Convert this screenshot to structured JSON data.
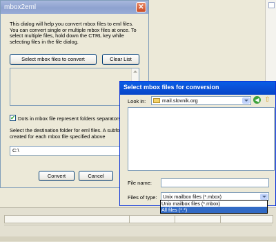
{
  "mbox2eml": {
    "title": "mbox2eml",
    "close_glyph": "✕",
    "description": "This dialog will help you convert mbox files to eml files. You can convert single or multiple mbox files at once. To select multiple files, hold down the CTRL key while selecting files in the file dialog.",
    "select_button": "Select mbox files to convert",
    "clear_button": "Clear List",
    "checkbox_label": "Dots in mbox file represent folders separators",
    "checkbox_checked": true,
    "destination_text": "Select the destination folder for eml files. A subfolder will be created for each mbox file specified above",
    "destination_value": "C:\\",
    "convert_button": "Convert",
    "cancel_button": "Cancel"
  },
  "file_dialog": {
    "title": "Select mbox files for conversion",
    "look_in_label": "Look in:",
    "look_in_value": "mail.slovnik.org",
    "file_name_label": "File name:",
    "file_name_value": "",
    "files_of_type_label": "Files of type:",
    "files_of_type_value": "Unix mailbox files (*.mbox)",
    "type_options": [
      "Unix mailbox files (*.mbox)",
      "All files (*.*)"
    ],
    "type_selected_index": 1
  },
  "icons": {
    "close": "close-icon",
    "folder": "folder-icon",
    "back": "back-icon",
    "up": "up-folder-icon",
    "dropdown": "chevron-down-icon"
  }
}
